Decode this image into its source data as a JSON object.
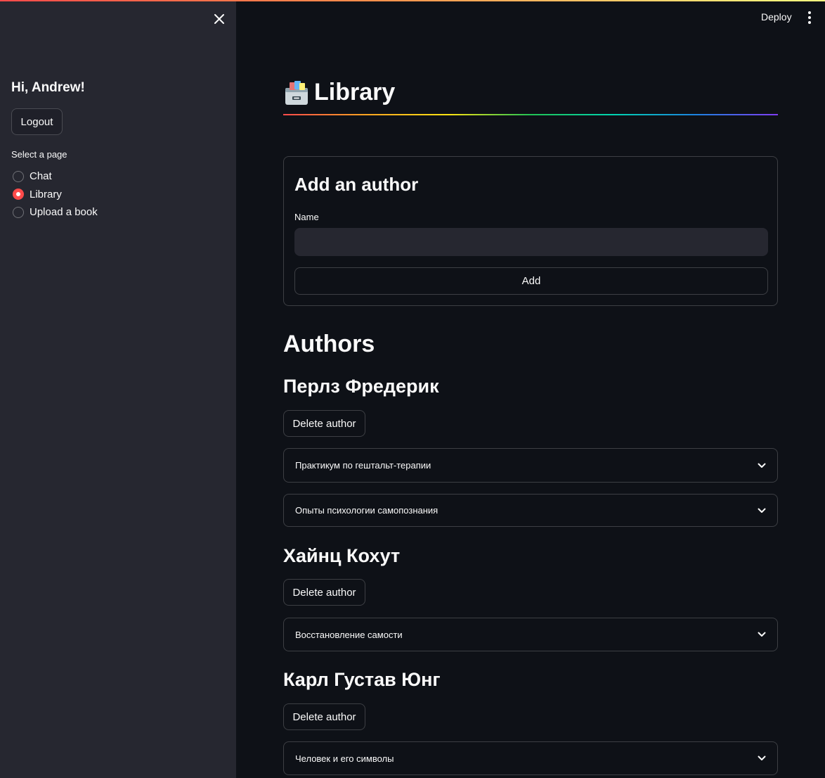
{
  "sidebar": {
    "greeting": "Hi, Andrew!",
    "logout_label": "Logout",
    "select_label": "Select a page",
    "pages": [
      {
        "label": "Chat",
        "selected": false
      },
      {
        "label": "Library",
        "selected": true
      },
      {
        "label": "Upload a book",
        "selected": false
      }
    ]
  },
  "header": {
    "deploy_label": "Deploy",
    "menu_icon": "more-vertical-icon",
    "close_icon": "close-icon"
  },
  "page": {
    "title_icon": "card-file-box-icon",
    "title": "Library"
  },
  "add_author_form": {
    "title": "Add an author",
    "name_label": "Name",
    "name_value": "",
    "add_label": "Add"
  },
  "authors_section": {
    "heading": "Authors",
    "delete_label": "Delete author",
    "authors": [
      {
        "name": "Перлз Фредерик",
        "books": [
          "Практикум по гештальт-терапии",
          "Опыты психологии самопознания"
        ]
      },
      {
        "name": "Хайнц Кохут",
        "books": [
          "Восстановление самости"
        ]
      },
      {
        "name": "Карл Густав Юнг",
        "books": [
          "Человек и его символы"
        ]
      }
    ]
  },
  "colors": {
    "accent": "#ff4b4b",
    "background": "#0e1117",
    "sidebar_background": "#262730",
    "text": "#fafafa"
  }
}
